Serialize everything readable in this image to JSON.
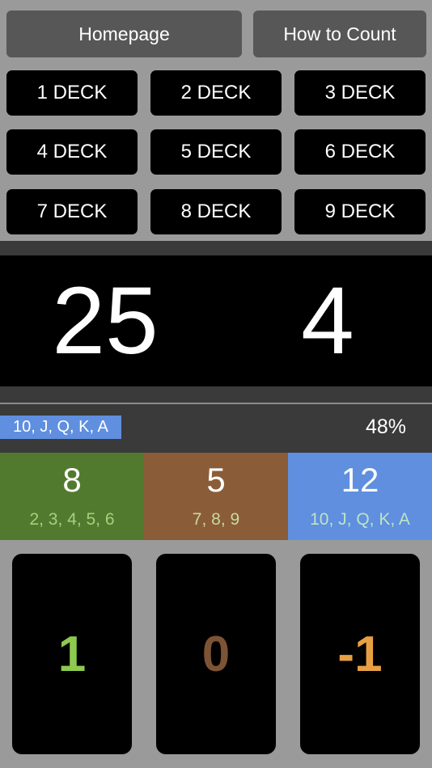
{
  "nav": {
    "homepage_label": "Homepage",
    "how_to_count_label": "How to Count"
  },
  "decks": [
    "1 DECK",
    "2 DECK",
    "3 DECK",
    "4 DECK",
    "5 DECK",
    "6 DECK",
    "7 DECK",
    "8 DECK",
    "9 DECK"
  ],
  "counter": {
    "cards_remaining": "25",
    "running_count": "4"
  },
  "progress": {
    "label": "10, J, Q, K, A",
    "percent_text": "48%",
    "fill_fraction": 1.0
  },
  "groups": [
    {
      "count": "8",
      "cards": "2, 3, 4, 5, 6",
      "bg_color": "#527a2e",
      "text_color": "#a3d27c"
    },
    {
      "count": "5",
      "cards": "7, 8, 9",
      "bg_color": "#8a5c38",
      "text_color": "#c8d9a0"
    },
    {
      "count": "12",
      "cards": "10, J, Q, K, A",
      "bg_color": "#5f8fde",
      "text_color": "#bfe3c6"
    }
  ],
  "value_buttons": [
    {
      "label": "1",
      "color": "#8ec94f"
    },
    {
      "label": "0",
      "color": "#7d5335"
    },
    {
      "label": "-1",
      "color": "#e6a043"
    }
  ]
}
